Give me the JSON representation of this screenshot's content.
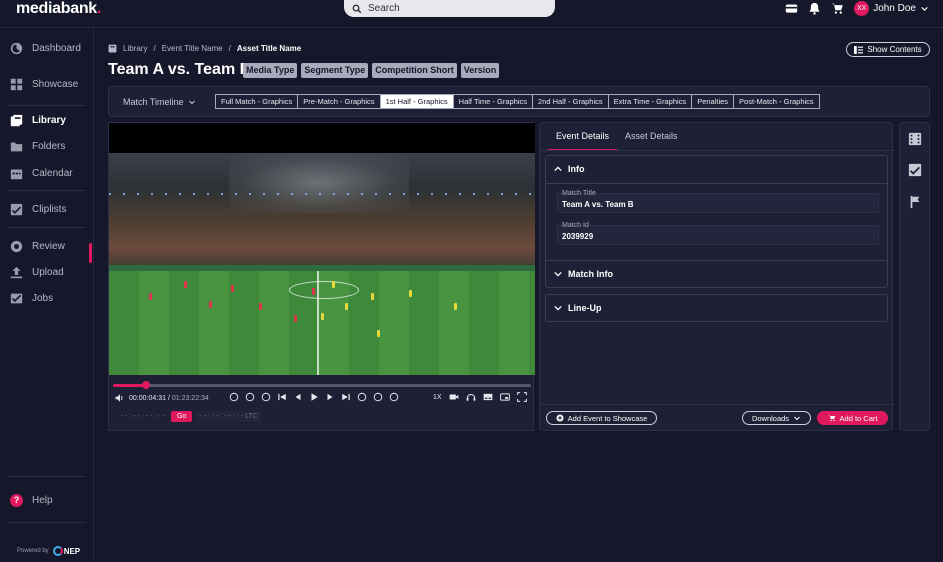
{
  "app": {
    "logo_text": "mediabank",
    "logo_dot": "."
  },
  "search": {
    "placeholder": "Search"
  },
  "user": {
    "initials": "XX",
    "name": "John Doe"
  },
  "sidebar": {
    "items": [
      {
        "label": "Dashboard",
        "icon": "dashboard-icon"
      },
      {
        "label": "Showcase",
        "icon": "showcase-icon"
      },
      {
        "label": "Library",
        "icon": "library-icon",
        "active": true
      },
      {
        "label": "Folders",
        "icon": "folder-icon"
      },
      {
        "label": "Calendar",
        "icon": "calendar-icon"
      },
      {
        "label": "Cliplists",
        "icon": "cliplist-icon"
      },
      {
        "label": "Review",
        "icon": "review-icon"
      },
      {
        "label": "Upload",
        "icon": "upload-icon"
      },
      {
        "label": "Jobs",
        "icon": "jobs-icon"
      }
    ],
    "help": "Help",
    "powered_by": "Powered by",
    "nep": "NEP"
  },
  "breadcrumb": {
    "library": "Library",
    "event": "Event Title Name",
    "asset": "Asset Title Name"
  },
  "header": {
    "title": "Team A vs. Team B",
    "show_contents": "Show Contents",
    "tags": [
      "Media Type",
      "Segment Type",
      "Competition Short",
      "Version"
    ]
  },
  "timeline": {
    "label": "Match Timeline",
    "tabs": [
      "Full Match - Graphics",
      "Pre-Match - Graphics",
      "1st Half - Graphics",
      "Half Time - Graphics",
      "2nd Half - Graphics",
      "Extra Time - Graphics",
      "Penalties",
      "Post-Match - Graphics"
    ],
    "active_index": 2
  },
  "player": {
    "current_time": "00:00:04:31",
    "separator": "/",
    "duration": "01:23:22:34",
    "speed": "1X",
    "timecode_in": "- - : - - : - - : - -",
    "go": "Go",
    "timecode_out": "- - : - - : - - : - -",
    "ltc": "LTC",
    "progress": 0.08
  },
  "details": {
    "tabs": [
      "Event Details",
      "Asset Details"
    ],
    "info": {
      "title": "Info",
      "match_title_label": "Match Title",
      "match_title_value": "Team A vs. Team B",
      "match_id_label": "Match Id",
      "match_id_value": "2039929"
    },
    "match_info": "Match Info",
    "line_up": "Line-Up",
    "add_event": "Add Event to Showcase",
    "downloads": "Downloads",
    "add_cart": "Add to Cart"
  },
  "colors": {
    "accent": "#e0195f",
    "background": "#16172a",
    "panel": "#1e2035"
  }
}
